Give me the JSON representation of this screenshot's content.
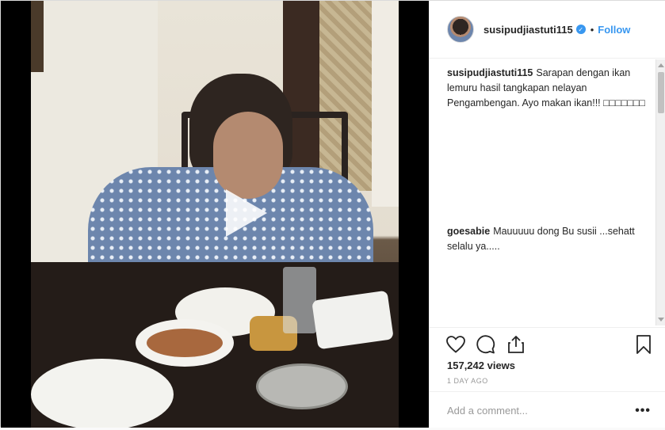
{
  "post": {
    "username": "susipudjiastuti115",
    "verified_icon": "verified-badge-icon",
    "follow_label": "Follow",
    "separator": "•"
  },
  "comments": [
    {
      "username": "susipudjiastuti115",
      "text": "Sarapan dengan ikan lemuru hasil tangkapan nelayan Pengambengan. Ayo makan ikan!!! □□□□□□□"
    },
    {
      "username": "goesabie",
      "text": "Mauuuuu dong Bu susii ...sehatt selalu ya....."
    }
  ],
  "actions": {
    "like_icon": "heart-icon",
    "comment_icon": "comment-bubble-icon",
    "share_icon": "share-icon",
    "save_icon": "bookmark-icon",
    "views": "157,242 views",
    "timestamp": "1 DAY AGO"
  },
  "add_comment": {
    "placeholder": "Add a comment...",
    "more_label": "•••"
  },
  "media": {
    "play_icon": "play-icon"
  }
}
